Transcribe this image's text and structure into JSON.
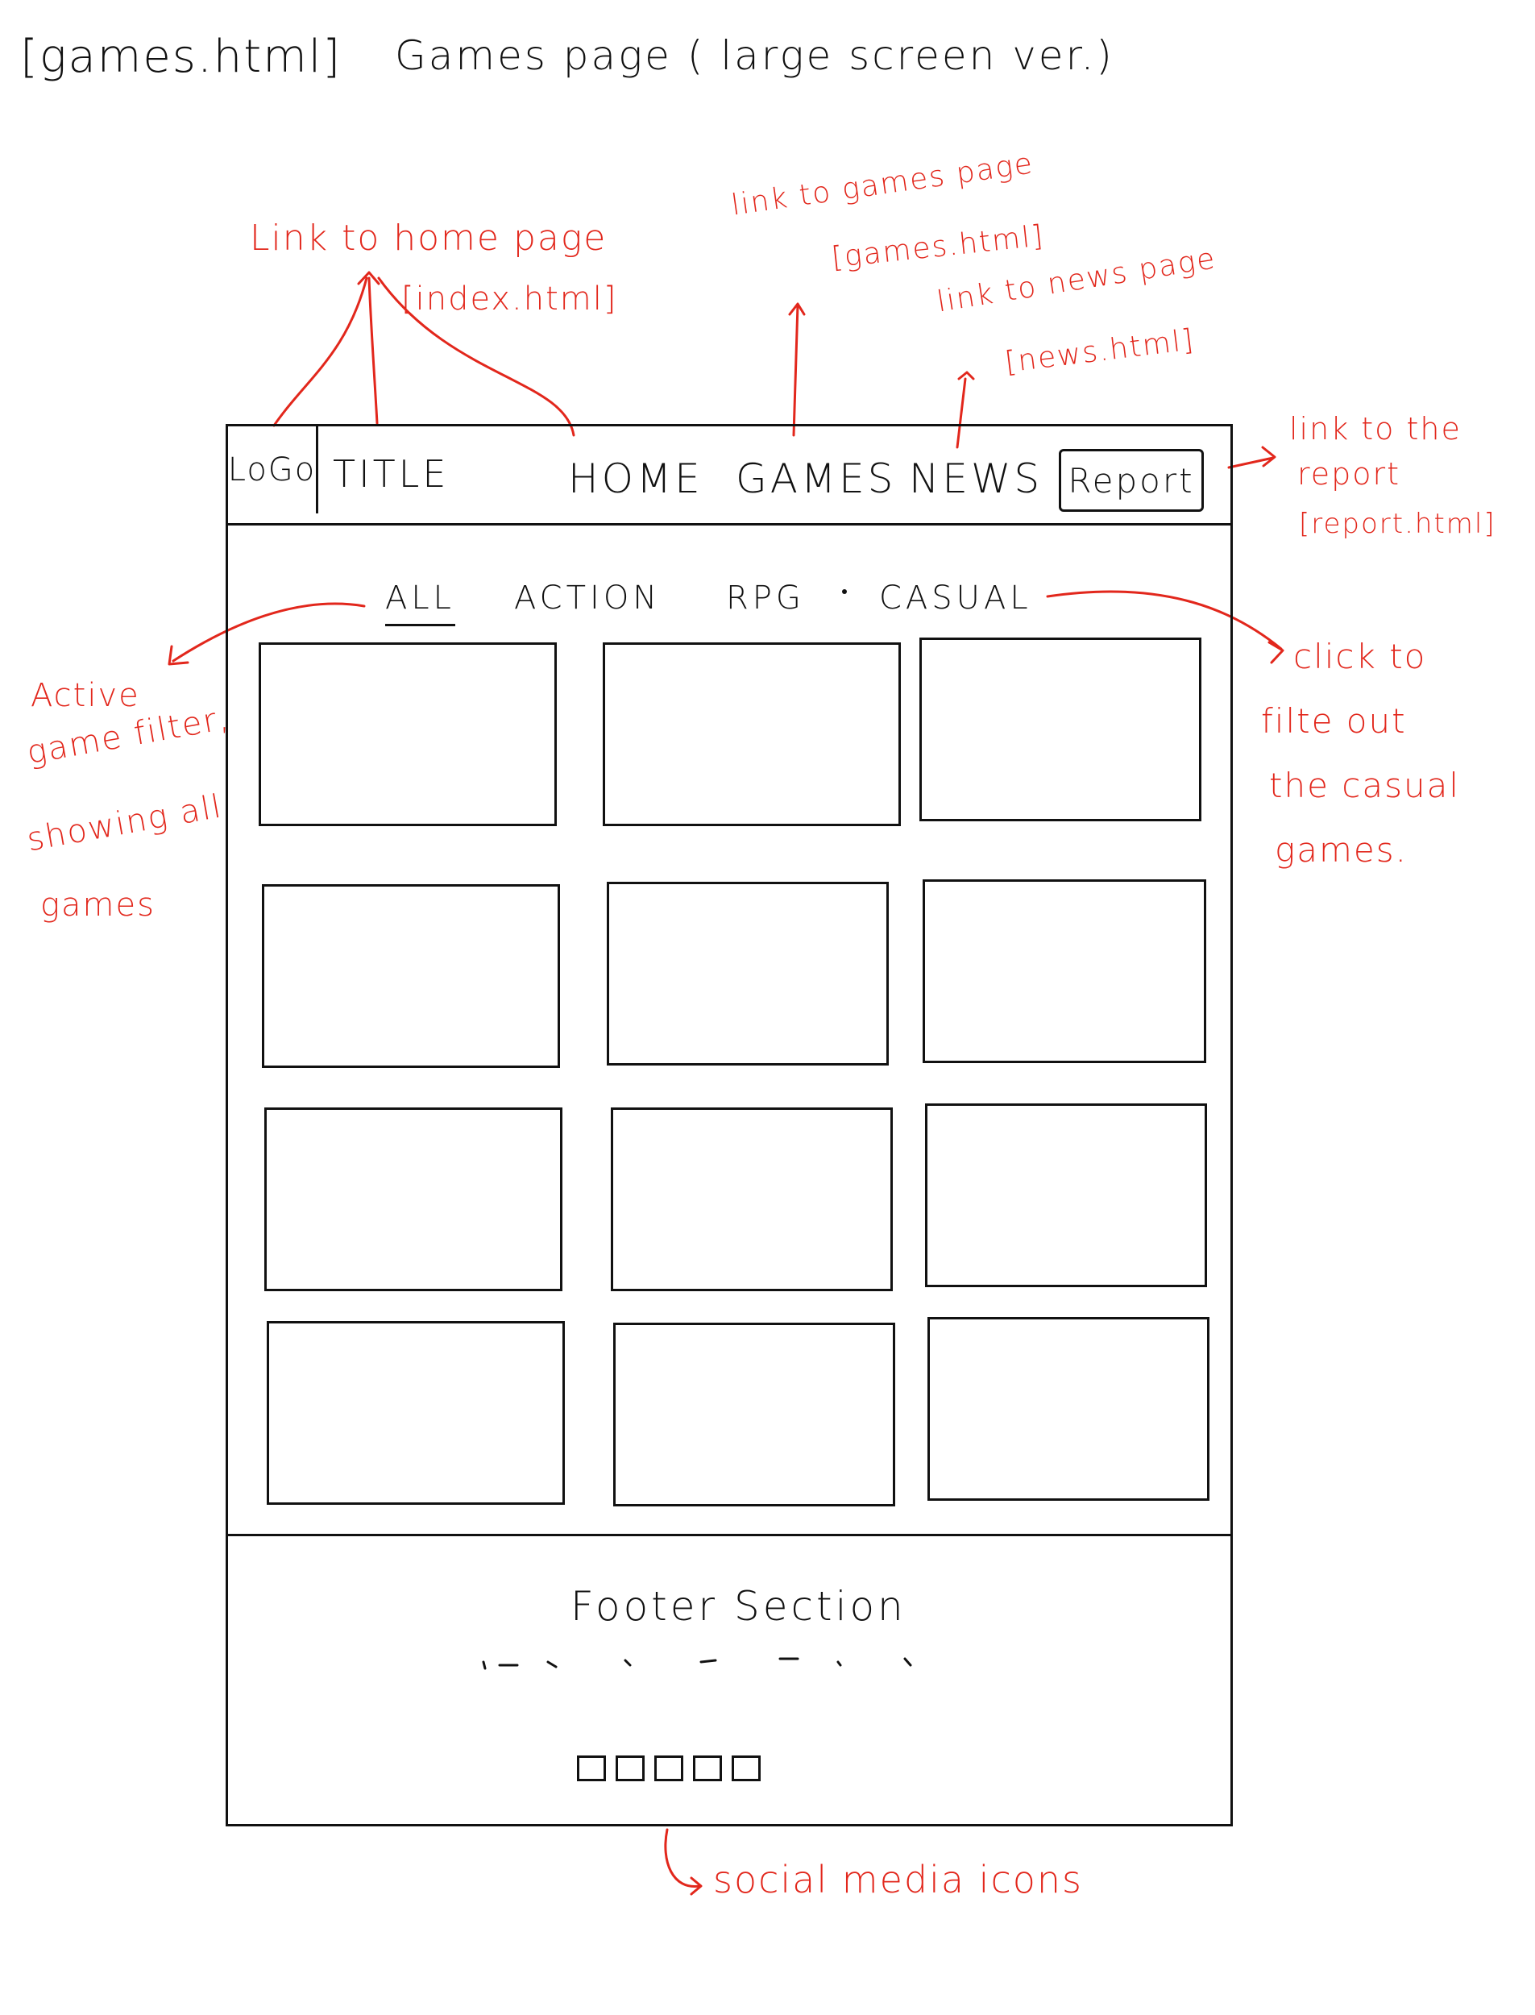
{
  "page": {
    "file_label": "[games.html]",
    "heading": "Games page ( large screen ver.)"
  },
  "header": {
    "logo": "LoGo",
    "title": "TITLE",
    "nav": {
      "home": "HOME",
      "games": "GAMES",
      "news": "NEWS",
      "report": "Report"
    }
  },
  "filters": {
    "all": "ALL",
    "action": "ACTION",
    "rpg": "RPG",
    "casual": "CASUAL",
    "active": "ALL"
  },
  "game_grid": {
    "rows": 4,
    "columns": 3
  },
  "footer": {
    "title": "Footer Section",
    "social_icon_count": 5
  },
  "annotations": {
    "home": {
      "line1": "Link to home page",
      "line2": "[index.html]"
    },
    "games": {
      "line1": "link to games page",
      "line2": "[games.html]"
    },
    "news": {
      "line1": "link to news page",
      "line2": "[news.html]"
    },
    "report": {
      "line1": "link to the",
      "line2": "report",
      "line3": "[report.html]"
    },
    "filter_active": {
      "line1": "Active",
      "line2": "game filter,",
      "line3": "showing all",
      "line4": "games"
    },
    "filter_casual": {
      "line1": "click to",
      "line2": "filte out",
      "line3": "the casual",
      "line4": "games."
    },
    "social": {
      "text": "social media icons"
    }
  },
  "colors": {
    "annotation": "#e2271c",
    "ink": "#111111"
  }
}
